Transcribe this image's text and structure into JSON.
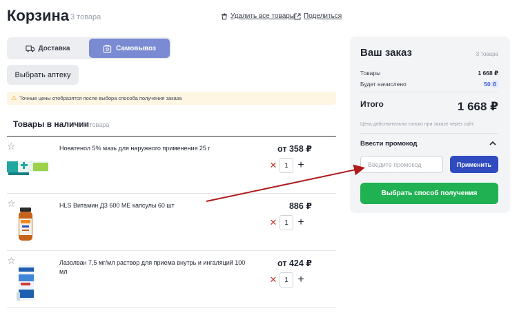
{
  "header": {
    "title": "Корзина",
    "count": "3 товара",
    "delete_all": "Удалить все товары",
    "share": "Поделиться"
  },
  "delivery_switch": {
    "delivery": "Доставка",
    "pickup": "Самовывоз",
    "selected": "Самовывоз"
  },
  "pharmacy_button": "Выбрать аптеку",
  "notice": "Точные цены отобразятся после выбора способа получения заказа",
  "section": {
    "title": "Товары в наличии",
    "count": "3 товара"
  },
  "items": [
    {
      "name": "Новатенол 5% мазь для наружного применения 25 г",
      "price": "от 358 ₽",
      "qty": "1",
      "image_icon": "ointment-box-icon"
    },
    {
      "name": "HLS Витамин Д3 600 МЕ капсулы 60 шт",
      "price": "886 ₽",
      "qty": "1",
      "image_icon": "vitamin-jar-icon"
    },
    {
      "name": "Лазолван 7,5 мг/мл раствор для приема внутрь и ингаляций 100 мл",
      "price": "от 424 ₽",
      "qty": "1",
      "image_icon": "medicine-box-icon"
    }
  ],
  "order": {
    "title": "Ваш заказ",
    "count": "3 товара",
    "goods_label": "Товары",
    "goods_value": "1 668 ₽",
    "bonus_label": "Будет начислено",
    "bonus_value": "50",
    "bonus_unit": "б",
    "total_label": "Итого",
    "total_value": "1 668 ₽",
    "note": "Цена действительна только при заказе через сайт.",
    "promo_title": "Ввести промокод",
    "promo_placeholder": "Введите промокод",
    "apply": "Применить",
    "choose": "Выбрать способ получения"
  },
  "colors": {
    "accent": "#7a8bd3",
    "apply": "#2f4bbf",
    "green": "#1fb152",
    "annotation_arrow": "#b01a1a"
  }
}
